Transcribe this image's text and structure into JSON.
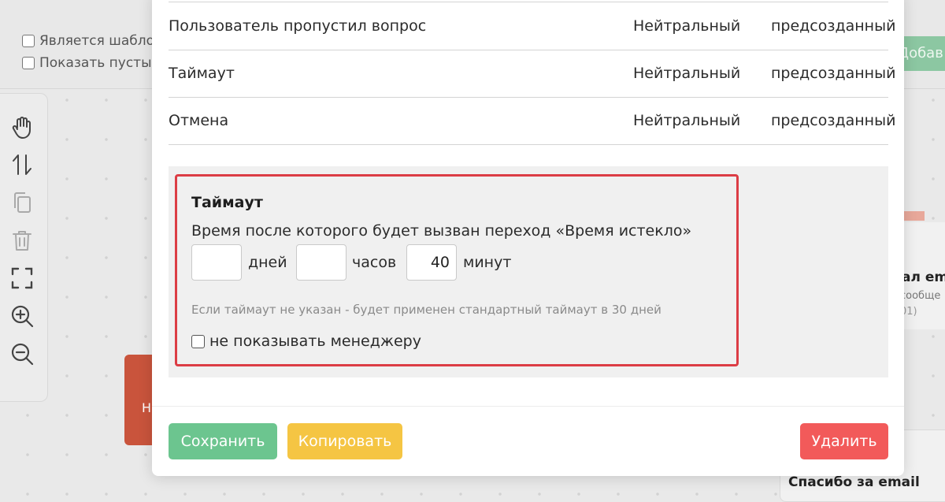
{
  "background": {
    "checkboxes": [
      {
        "label": "Является шаблон"
      },
      {
        "label": "Показать пустые в"
      }
    ],
    "add_button_label": "Добав",
    "red_node_label": "Н",
    "right_card": {
      "title": "ал em",
      "subtitle": "сообще",
      "meta": "01)"
    },
    "bottom_card_title": "Спасибо за email",
    "toolbar_icons": [
      "hand-icon",
      "swap-vertical-icon",
      "copy-icon",
      "trash-icon",
      "fullscreen-icon",
      "zoom-in-icon",
      "zoom-out-icon"
    ]
  },
  "modal": {
    "events": [
      {
        "name": "Пользователь пропустил вопрос",
        "type": "Нейтральный",
        "origin": "предсозданный"
      },
      {
        "name": "Таймаут",
        "type": "Нейтральный",
        "origin": "предсозданный"
      },
      {
        "name": "Отмена",
        "type": "Нейтральный",
        "origin": "предсозданный"
      }
    ],
    "timeout": {
      "title": "Таймаут",
      "description": "Время после которого будет вызван переход «Время истекло»",
      "days_value": "",
      "days_label": "дней",
      "hours_value": "",
      "hours_label": "часов",
      "minutes_value": "40",
      "minutes_label": "минут",
      "hint": "Если таймаут не указан - будет применен стандартный таймаут в 30 дней",
      "hide_from_manager_label": "не показывать менеджеру",
      "hide_from_manager_checked": false
    },
    "buttons": {
      "save": "Сохранить",
      "copy": "Копировать",
      "delete": "Удалить"
    },
    "colors": {
      "highlight_border": "#dc3d45",
      "save": "#6cc58f",
      "copy": "#f5c543",
      "delete": "#f25a5a"
    }
  }
}
